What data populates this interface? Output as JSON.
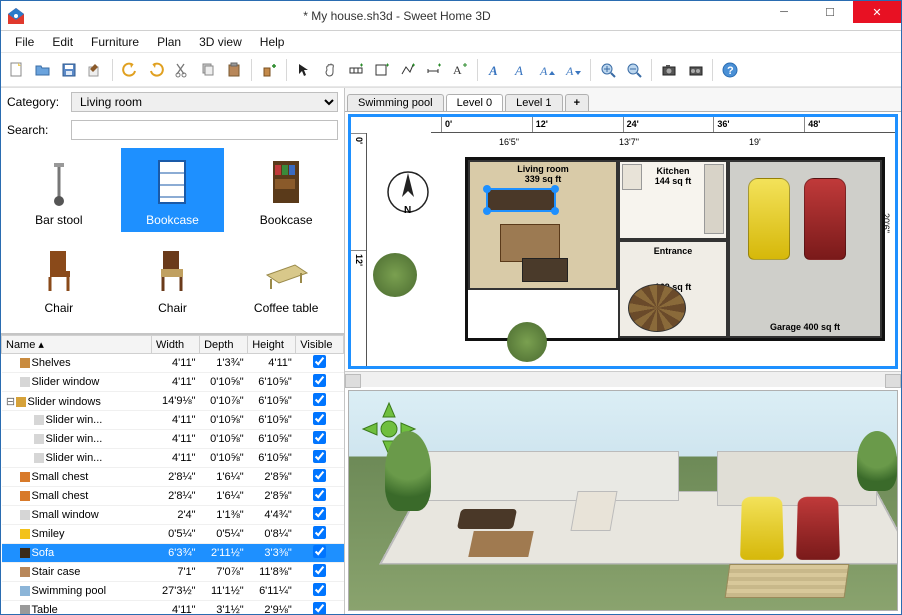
{
  "window": {
    "title": "* My house.sh3d - Sweet Home 3D"
  },
  "menu": [
    "File",
    "Edit",
    "Furniture",
    "Plan",
    "3D view",
    "Help"
  ],
  "category_label": "Category:",
  "search_label": "Search:",
  "category_value": "Living room",
  "search_value": "",
  "catalog": [
    {
      "label": "Bar stool",
      "sel": false
    },
    {
      "label": "Bookcase",
      "sel": true
    },
    {
      "label": "Bookcase",
      "sel": false
    },
    {
      "label": "Chair",
      "sel": false
    },
    {
      "label": "Chair",
      "sel": false
    },
    {
      "label": "Coffee table",
      "sel": false
    }
  ],
  "table": {
    "headers": [
      "Name",
      "Width",
      "Depth",
      "Height",
      "Visible"
    ],
    "sort_col": "Name",
    "rows": [
      {
        "indent": 1,
        "icon": "#c98b3f",
        "name": "Shelves",
        "w": "4'11\"",
        "d": "1'3¾\"",
        "h": "4'11\"",
        "v": true
      },
      {
        "indent": 1,
        "icon": "#d6d6d6",
        "name": "Slider window",
        "w": "4'11\"",
        "d": "0'10⅝\"",
        "h": "6'10⅝\"",
        "v": true
      },
      {
        "indent": 0,
        "exp": "minus",
        "icon": "#d6a23a",
        "name": "Slider windows",
        "w": "14'9⅛\"",
        "d": "0'10⅞\"",
        "h": "6'10⅝\"",
        "v": true
      },
      {
        "indent": 2,
        "icon": "#d6d6d6",
        "name": "Slider win...",
        "w": "4'11\"",
        "d": "0'10⅝\"",
        "h": "6'10⅝\"",
        "v": true
      },
      {
        "indent": 2,
        "icon": "#d6d6d6",
        "name": "Slider win...",
        "w": "4'11\"",
        "d": "0'10⅝\"",
        "h": "6'10⅝\"",
        "v": true
      },
      {
        "indent": 2,
        "icon": "#d6d6d6",
        "name": "Slider win...",
        "w": "4'11\"",
        "d": "0'10⅝\"",
        "h": "6'10⅝\"",
        "v": true
      },
      {
        "indent": 1,
        "icon": "#d87a2a",
        "name": "Small chest",
        "w": "2'8¼\"",
        "d": "1'6¼\"",
        "h": "2'8⅝\"",
        "v": true
      },
      {
        "indent": 1,
        "icon": "#d87a2a",
        "name": "Small chest",
        "w": "2'8¼\"",
        "d": "1'6¼\"",
        "h": "2'8⅝\"",
        "v": true
      },
      {
        "indent": 1,
        "icon": "#d6d6d6",
        "name": "Small window",
        "w": "2'4\"",
        "d": "1'1⅜\"",
        "h": "4'4¾\"",
        "v": true
      },
      {
        "indent": 1,
        "icon": "#f3c21b",
        "name": "Smiley",
        "w": "0'5¼\"",
        "d": "0'5¼\"",
        "h": "0'8¼\"",
        "v": true
      },
      {
        "indent": 1,
        "icon": "#3a2a1a",
        "name": "Sofa",
        "w": "6'3¾\"",
        "d": "2'11½\"",
        "h": "3'3⅜\"",
        "v": true,
        "sel": true
      },
      {
        "indent": 1,
        "icon": "#b8875a",
        "name": "Stair case",
        "w": "7'1\"",
        "d": "7'0⅞\"",
        "h": "11'8⅜\"",
        "v": true
      },
      {
        "indent": 1,
        "icon": "#8cb5d8",
        "name": "Swimming pool",
        "w": "27'3½\"",
        "d": "11'1½\"",
        "h": "6'11¼\"",
        "v": true
      },
      {
        "indent": 1,
        "icon": "#9a9a9a",
        "name": "Table",
        "w": "4'11\"",
        "d": "3'1½\"",
        "h": "2'9⅛\"",
        "v": true
      }
    ]
  },
  "tabs": [
    {
      "label": "Swimming pool",
      "active": false
    },
    {
      "label": "Level 0",
      "active": true
    },
    {
      "label": "Level 1",
      "active": false
    }
  ],
  "ruler_h": [
    "0'",
    "12'",
    "24'",
    "36'",
    "48'"
  ],
  "ruler_v": [
    "0'",
    "12'"
  ],
  "plan": {
    "dims_top": [
      {
        "label": "16'5\""
      },
      {
        "label": "13'7\""
      },
      {
        "label": "19'"
      }
    ],
    "dim_right": "20'6\"",
    "rooms": {
      "living": {
        "name": "Living room",
        "area": "339 sq ft"
      },
      "kitchen": {
        "name": "Kitchen",
        "area": "144 sq ft"
      },
      "entrance": {
        "name": "Entrance",
        "area": "169 sq ft"
      },
      "garage": {
        "name": "Garage",
        "area": "400 sq ft"
      }
    },
    "compass_label": "N"
  }
}
